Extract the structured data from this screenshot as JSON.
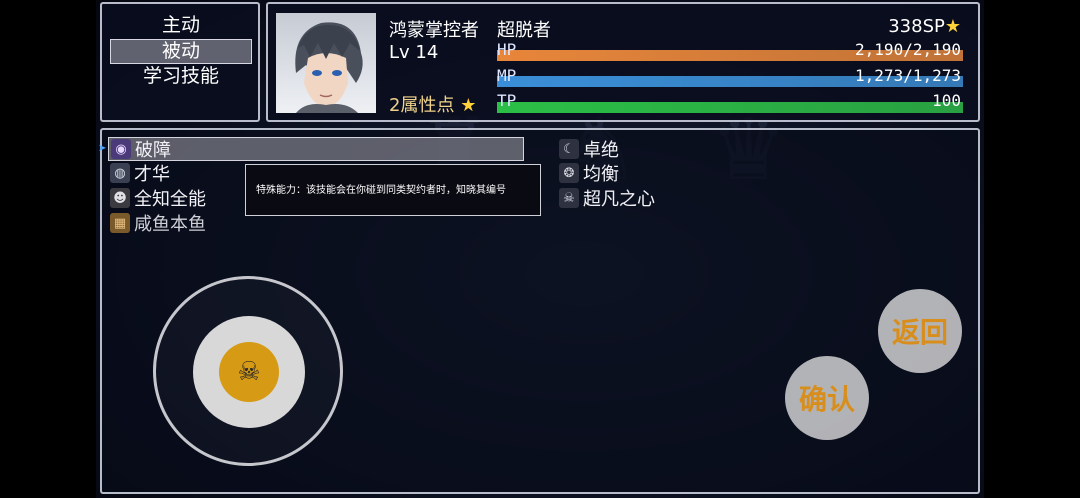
{
  "menu": {
    "items": [
      {
        "label": "主动",
        "selected": false
      },
      {
        "label": "被动",
        "selected": true
      },
      {
        "label": "学习技能",
        "selected": false
      }
    ]
  },
  "character": {
    "name": "鸿蒙掌控者",
    "title": "超脱者",
    "level_label": "Lv",
    "level": "14",
    "sp": "338SP",
    "attribute_points": "2属性点",
    "hp": {
      "label": "HP",
      "value": "2,190/2,190",
      "ratio": 1.0
    },
    "mp": {
      "label": "MP",
      "value": "1,273/1,273",
      "ratio": 1.0
    },
    "tp": {
      "label": "TP",
      "value": "100",
      "ratio": 1.0
    }
  },
  "skills": {
    "left": [
      {
        "label": "破障",
        "icon": "eye-icon",
        "selected": true
      },
      {
        "label": "才华",
        "icon": "planet-icon",
        "selected": false
      },
      {
        "label": "全知全能",
        "icon": "mask-icon",
        "selected": false
      },
      {
        "label": "咸鱼本鱼",
        "icon": "grid-icon",
        "selected": false
      }
    ],
    "right": [
      {
        "label": "卓绝",
        "icon": "scythe-icon"
      },
      {
        "label": "均衡",
        "icon": "swirl-icon"
      },
      {
        "label": "超凡之心",
        "icon": "skull-icon"
      }
    ]
  },
  "tooltip": {
    "text": "特殊能力：该技能会在你碰到同类契约者时，知晓其编号"
  },
  "buttons": {
    "back": "返回",
    "confirm": "确认"
  },
  "colors": {
    "hp": "#e8863a",
    "mp": "#3a8fd8",
    "tp": "#2bbf46",
    "accent": "#d88e1c"
  }
}
